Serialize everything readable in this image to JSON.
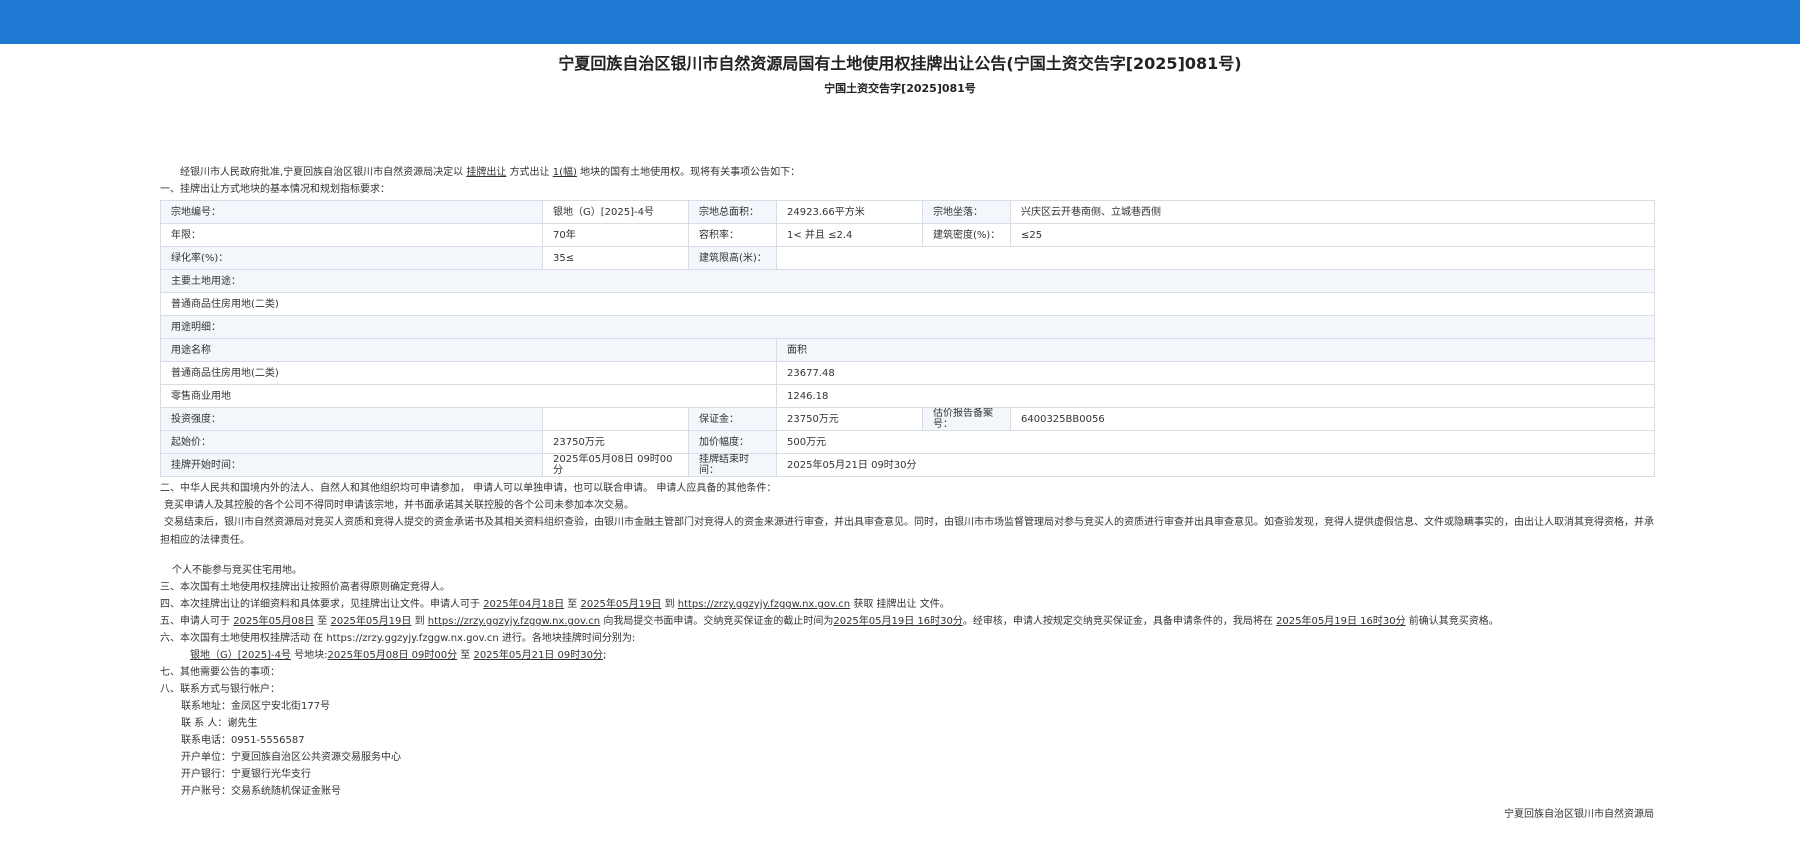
{
  "title": "宁夏回族自治区银川市自然资源局国有土地使用权挂牌出让公告(宁国土资交告字[2025]081号)",
  "subtitle": "宁国土资交告字[2025]081号",
  "intro": {
    "pre": "经银川市人民政府批准,宁夏回族自治区银川市自然资源局决定以",
    "method": "挂牌出让",
    "mid": "方式出让",
    "count": "1(幅)",
    "post": "地块的国有土地使用权。现将有关事项公告如下："
  },
  "section1": "一、挂牌出让方式地块的基本情况和规划指标要求：",
  "table": {
    "parcel_no_label": "宗地编号：",
    "parcel_no": "银地（G）[2025]-4号",
    "area_label": "宗地总面积：",
    "area": "24923.66平方米",
    "location_label": "宗地坐落：",
    "location": "兴庆区云开巷南侧、立城巷西侧",
    "years_label": "年限：",
    "years": "70年",
    "far_label": "容积率：",
    "far": "1< 并且 ≤2.4",
    "density_label": "建筑密度(%)：",
    "density": "≤25",
    "green_label": "绿化率(%)：",
    "green": "35≤",
    "height_label": "建筑限高(米)：",
    "height": "",
    "main_use_label": "主要土地用途：",
    "main_use": "普通商品住房用地(二类)",
    "use_detail_label": "用途明细：",
    "use_name_header": "用途名称",
    "use_area_header": "面积",
    "uses": [
      {
        "name": "普通商品住房用地(二类)",
        "area": "23677.48"
      },
      {
        "name": "零售商业用地",
        "area": "1246.18"
      }
    ],
    "invest_label": "投资强度：",
    "invest": "",
    "deposit_label": "保证金：",
    "deposit": "23750万元",
    "report_label": "估价报告备案号：",
    "report": "6400325BB0056",
    "start_price_label": "起始价：",
    "start_price": "23750万元",
    "increment_label": "加价幅度：",
    "increment": "500万元",
    "start_time_label": "挂牌开始时间：",
    "start_time": "2025年05月08日 09时00分",
    "end_time_label": "挂牌结束时间：",
    "end_time": "2025年05月21日 09时30分"
  },
  "section2": "二、中华人民共和国境内外的法人、自然人和其他组织均可申请参加， 申请人可以单独申请，也可以联合申请。 申请人应具备的其他条件：",
  "s2_line1": "竞买申请人及其控股的各个公司不得同时申请该宗地，并书面承诺其关联控股的各个公司未参加本次交易。",
  "s2_line2": "交易结束后，银川市自然资源局对竞买人资质和竞得人提交的资金承诺书及其相关资料组织查验，由银川市金融主管部门对竞得人的资金来源进行审查，并出具审查意见。同时，由银川市市场监督管理局对参与竞买人的资质进行审查并出具审查意见。如查验发现，竞得人提供虚假信息、文件或隐瞒事实的，由出让人取消其竞得资格，并承担相应的法律责任。",
  "s2_line3": "个人不能参与竞买住宅用地。",
  "section3": "三、本次国有土地使用权挂牌出让按照价高者得原则确定竞得人。",
  "section4": {
    "pre": "四、本次挂牌出让的详细资料和具体要求，见挂牌出让文件。申请人可于",
    "d1": "2025年04月18日",
    "to": "至",
    "d2": "2025年05月19日",
    "at": "到",
    "url": "https://zrzy.ggzyjy.fzggw.nx.gov.cn",
    "post": "获取 挂牌出让 文件。"
  },
  "section5": {
    "pre": "五、申请人可于",
    "d1": "2025年05月08日",
    "to": "至",
    "d2": "2025年05月19日",
    "at": "到",
    "url": "https://zrzy.ggzyjy.fzggw.nx.gov.cn",
    "mid": "向我局提交书面申请。交纳竞买保证金的截止时间为",
    "deadline": "2025年05月19日 16时30分",
    "mid2": "。经审核，申请人按规定交纳竞买保证金，具备申请条件的，我局将在",
    "confirm": "2025年05月19日 16时30分",
    "post": "前确认其竞买资格。"
  },
  "section6": "六、本次国有土地使用权挂牌活动 在 https://zrzy.ggzyjy.fzggw.nx.gov.cn 进行。各地块挂牌时间分别为:",
  "s6_line": {
    "parcel": "银地（G）[2025]-4号",
    "label": "号地块:",
    "start": "2025年05月08日 09时00分",
    "to": "至",
    "end": "2025年05月21日 09时30分",
    "tail": ";"
  },
  "section7": "七、其他需要公告的事项：",
  "section8": "八、联系方式与银行帐户：",
  "contacts": [
    "联系地址：金凤区宁安北街177号",
    "联 系 人：谢先生",
    "联系电话：0951-5556587",
    "开户单位：宁夏回族自治区公共资源交易服务中心",
    "开户银行：宁夏银行光华支行",
    "开户账号：交易系统随机保证金账号"
  ],
  "signature": "宁夏回族自治区银川市自然资源局",
  "colors": {
    "topbar": "#1f78d1",
    "label_bg": "#f3f6fa",
    "border": "#d6dde6"
  }
}
